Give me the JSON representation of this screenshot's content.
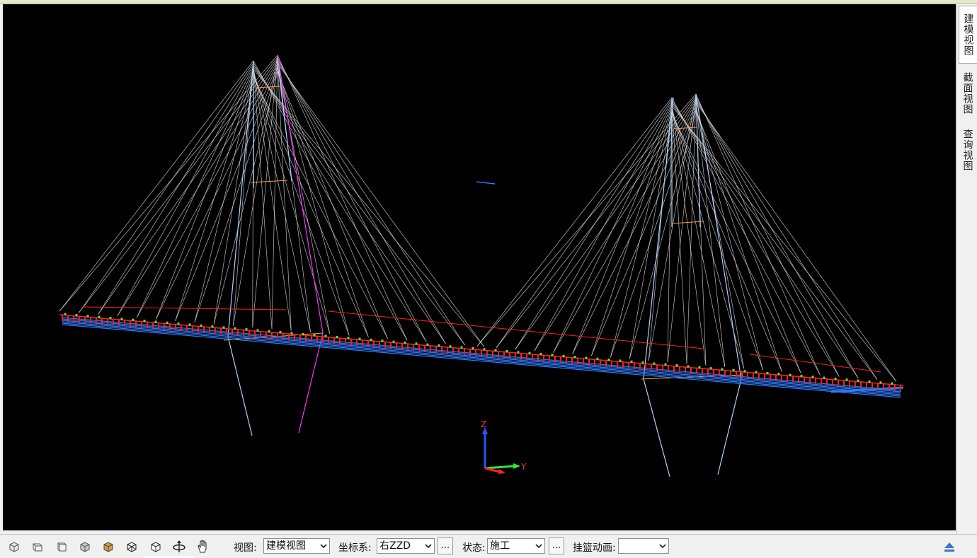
{
  "viewport": {
    "axis": {
      "z_label": "Z",
      "y_label": "Y",
      "x_label": "X"
    }
  },
  "side_tabs": [
    {
      "label": "建模视图",
      "active": true
    },
    {
      "label": "截面视图",
      "active": false
    },
    {
      "label": "查询视图",
      "active": false
    }
  ],
  "toolbar": {
    "icons": [
      "box-front-view-icon",
      "box-top-view-icon",
      "box-side-view-icon",
      "box-shaded-view-icon",
      "box-textured-view-icon",
      "box-wireframe-view-icon",
      "box-iso-view-icon",
      "rotate-view-icon",
      "pan-hand-icon"
    ],
    "view_label": "视图:",
    "view_value": "建模视图",
    "coord_label": "坐标系:",
    "coord_value": "右ZZD",
    "coord_more": "...",
    "state_label": "状态:",
    "state_value": "施工",
    "state_more": "...",
    "cradle_label": "挂篮动画:",
    "cradle_value": ""
  },
  "colors": {
    "background": "#000000",
    "cable": "#d8d8d8",
    "deck_beam": "#2a7bff",
    "rigid_link": "#ff1e1e",
    "node": "#46ff2a",
    "pylon": "#a8d4ff",
    "magenta_member": "#ff33ff",
    "crossbeam": "#ff9a3c"
  }
}
